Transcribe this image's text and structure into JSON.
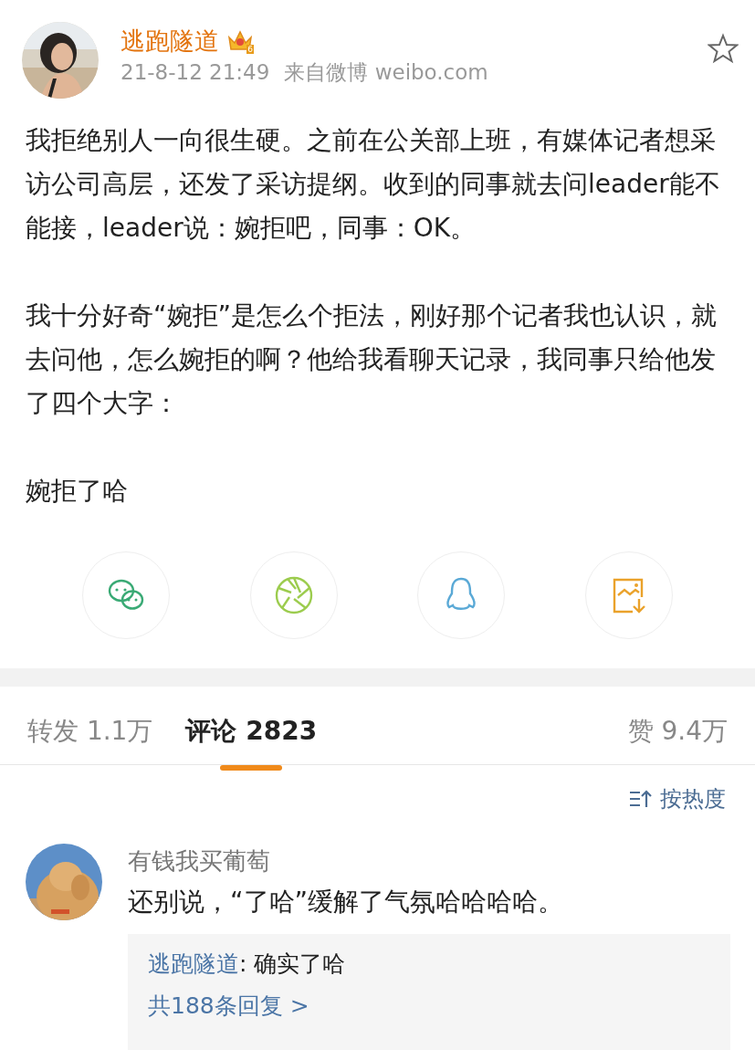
{
  "post": {
    "author": "逃跑隧道",
    "vip_level": "6",
    "time": "21-8-12 21:49",
    "source": "来自微博 weibo.com",
    "favorited": false,
    "paragraphs": [
      "我拒绝别人一向很生硬。之前在公关部上班，有媒体记者想采访公司高层，还发了采访提纲。收到的同事就去问leader能不能接，leader说：婉拒吧，同事：OK。",
      "我十分好奇“婉拒”是怎么个拒法，刚好那个记者我也认识，就去问他，怎么婉拒的啊？他给我看聊天记录，我同事只给他发了四个大字：",
      "婉拒了哈"
    ]
  },
  "share_buttons": [
    {
      "kind": "wechat",
      "color": "#3aaa75"
    },
    {
      "kind": "moments",
      "color": "#9ccc4e"
    },
    {
      "kind": "qq",
      "color": "#5aa9d6"
    },
    {
      "kind": "save",
      "color": "#eaa22b"
    }
  ],
  "tabs": [
    {
      "label": "转发 1.1万",
      "selected": false
    },
    {
      "label": "评论 2823",
      "selected": true
    },
    {
      "label": "赞 9.4万",
      "selected": false
    }
  ],
  "sort": {
    "label": "按热度"
  },
  "comments": [
    {
      "author": "有钱我买葡萄",
      "text": "还别说，“了哈”缓解了气氛哈哈哈哈。",
      "reply": {
        "author": "逃跑隧道",
        "text": ": 确实了哈"
      },
      "more": "共188条回复 >"
    }
  ]
}
